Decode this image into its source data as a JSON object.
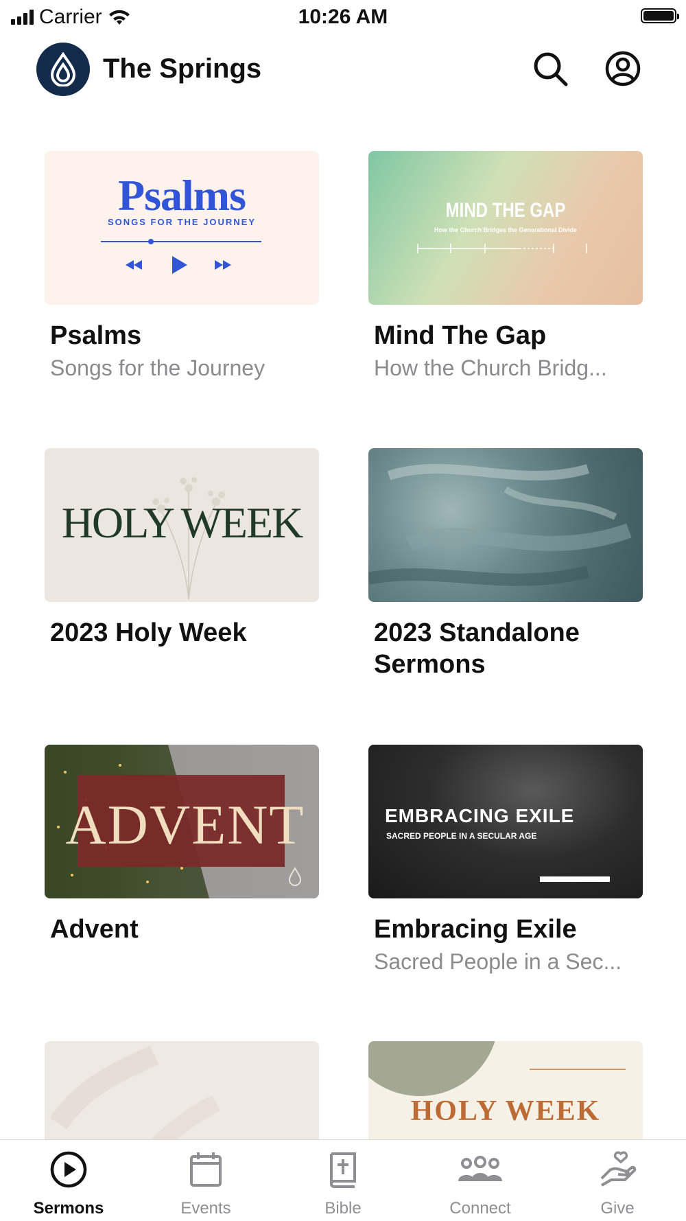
{
  "status_bar": {
    "carrier": "Carrier",
    "time": "10:26 AM"
  },
  "header": {
    "app_name": "The Springs",
    "search_icon": "search-icon",
    "account_icon": "account-circle-icon"
  },
  "series": [
    {
      "title": "Psalms",
      "subtitle": "Songs for the Journey",
      "art_title": "Psalms",
      "art_subtitle": "SONGS FOR THE JOURNEY"
    },
    {
      "title": "Mind The Gap",
      "subtitle": "How the Church Bridg...",
      "art_title": "MIND THE GAP",
      "art_subtitle": "How the Church Bridges the Generational Divide"
    },
    {
      "title": "2023 Holy Week",
      "subtitle": "",
      "art_title": "HOLY WEEK"
    },
    {
      "title": "2023 Standalone Sermons",
      "subtitle": ""
    },
    {
      "title": "Advent",
      "subtitle": "",
      "art_title": "ADVENT"
    },
    {
      "title": "Embracing Exile",
      "subtitle": "Sacred People in a Sec...",
      "art_title": "EMBRACING EXILE",
      "art_subtitle": "SACRED PEOPLE IN A SECULAR AGE"
    },
    {
      "title": "",
      "subtitle": ""
    },
    {
      "title": "",
      "subtitle": "",
      "art_title": "HOLY WEEK"
    }
  ],
  "tabs": [
    {
      "label": "Sermons",
      "icon": "play-circle-icon",
      "active": true
    },
    {
      "label": "Events",
      "icon": "calendar-icon",
      "active": false
    },
    {
      "label": "Bible",
      "icon": "bible-icon",
      "active": false
    },
    {
      "label": "Connect",
      "icon": "people-icon",
      "active": false
    },
    {
      "label": "Give",
      "icon": "give-heart-hand-icon",
      "active": false
    }
  ],
  "colors": {
    "brand": "#142b4b",
    "active_tab": "#111111",
    "inactive_tab": "#8e8e93"
  }
}
